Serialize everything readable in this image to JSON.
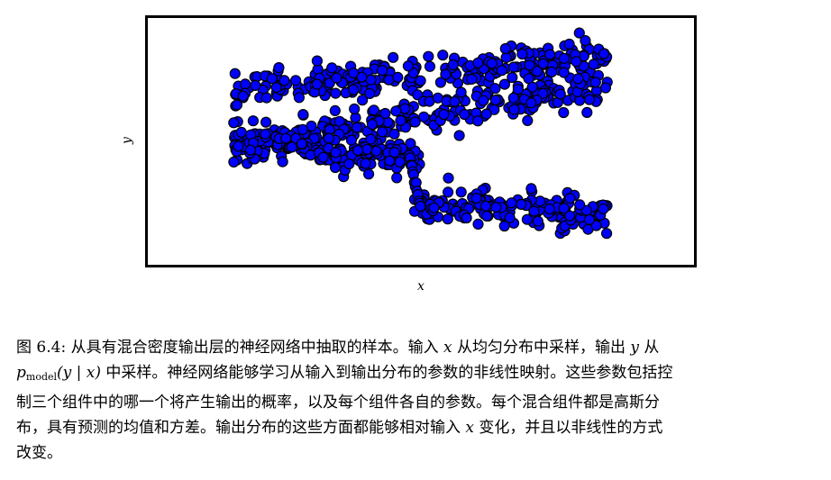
{
  "figure": {
    "xlabel": "x",
    "ylabel": "y",
    "point_color": "#0000ff",
    "point_edge_color": "#000000"
  },
  "chart_data": {
    "type": "scatter",
    "xlabel": "x",
    "ylabel": "y",
    "grid": false,
    "branches": [
      {
        "x_range": [
          0.0,
          1.0
        ],
        "y_center_start": 0.7,
        "y_center_end": 0.85
      },
      {
        "x_range": [
          0.0,
          1.0
        ],
        "y_center_start": 0.48,
        "y_center_end": 0.72
      },
      {
        "x_range": [
          0.0,
          0.5
        ],
        "y_center_start": 0.48,
        "y_center_end": 0.44
      },
      {
        "x_range": [
          0.48,
          1.0
        ],
        "y_center_start": 0.25,
        "y_center_end": 0.2
      }
    ]
  },
  "caption": {
    "line1_prefix": "图 6.4: 从具有混合密度输出层的神经网络中抽取的样本。输入 ",
    "line1_var": "x",
    "line1_mid": " 从均匀分布中采样，输出 ",
    "line1_var2": "y",
    "line1_suffix": " 从",
    "line2_p": "p",
    "line2_sub": "model",
    "line2_args": "(y | x)",
    "line2_rest": " 中采样。神经网络能够学习从输入到输出分布的参数的非线性映射。这些参数包括控",
    "line3": "制三个组件中的哪一个将产生输出的概率，以及每个组件各自的参数。每个混合组件都是高斯分",
    "line4_prefix": "布，具有预测的均值和方差。输出分布的这些方面都能够相对输入 ",
    "line4_var": "x",
    "line4_suffix": " 变化，并且以非线性的方式",
    "line5": "改变。"
  }
}
